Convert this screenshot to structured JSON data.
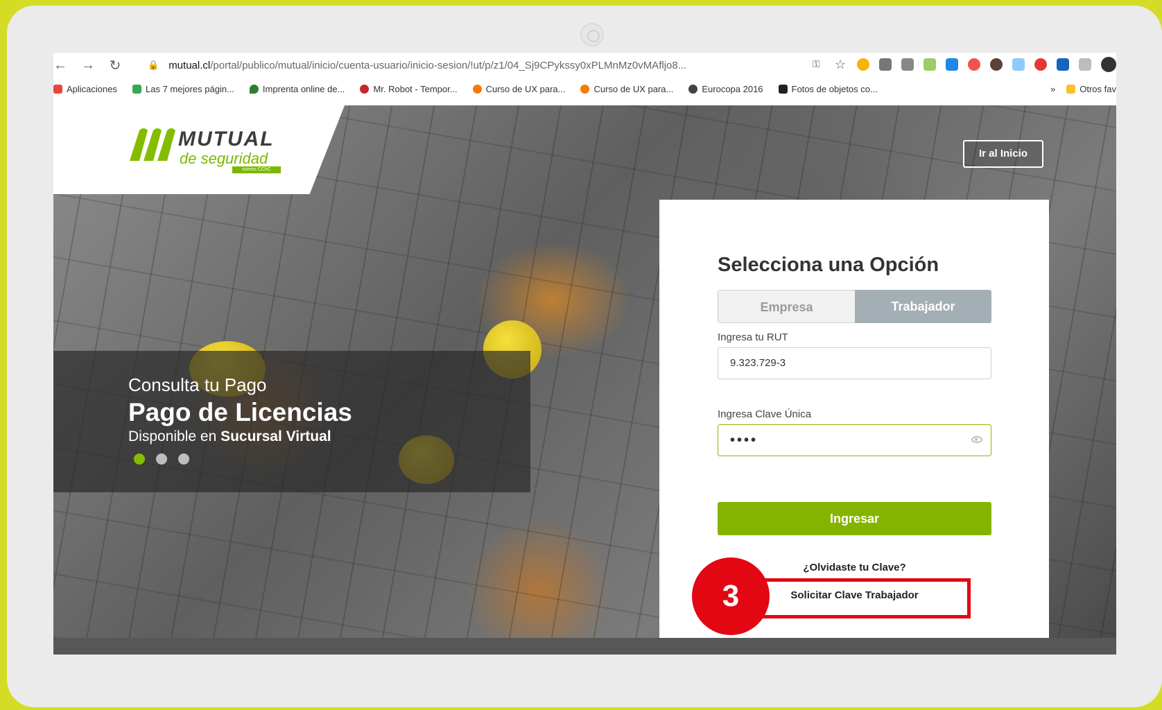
{
  "browser": {
    "url_domain": "mutual.cl",
    "url_path": "/portal/publico/mutual/inicio/cuenta-usuario/inicio-sesion/!ut/p/z1/04_Sj9CPykssy0xPLMnMz0vMAfljo8...",
    "bookmarks": [
      {
        "label": "Aplicaciones",
        "color": "#e8453c"
      },
      {
        "label": "Las 7 mejores págin...",
        "color": "#34a853"
      },
      {
        "label": "Imprenta online de...",
        "color": "#2e7d32"
      },
      {
        "label": "Mr. Robot - Tempor...",
        "color": "#c62828"
      },
      {
        "label": "Curso de UX para...",
        "color": "#f57c00"
      },
      {
        "label": "Curso de UX para...",
        "color": "#f57c00"
      },
      {
        "label": "Eurocopa 2016",
        "color": "#424242"
      },
      {
        "label": "Fotos de objetos co...",
        "color": "#212121"
      }
    ],
    "more_label": "»",
    "other_favorites": "Otros fav"
  },
  "site": {
    "logo": {
      "line1": "MUTUAL",
      "line2": "de seguridad",
      "tag": "somos CChC"
    },
    "ir_inicio": "Ir al Inicio",
    "slide": {
      "subtitle": "Consulta tu Pago",
      "title": "Pago de Licencias",
      "line_prefix": "Disponible en ",
      "line_bold": "Sucursal Virtual"
    }
  },
  "login": {
    "title": "Selecciona una Opción",
    "tab_empresa": "Empresa",
    "tab_trabajador": "Trabajador",
    "rut_label": "Ingresa tu RUT",
    "rut_value": "9.323.729-3",
    "clave_label": "Ingresa Clave Única",
    "clave_value": "••••",
    "submit": "Ingresar",
    "forgot": "¿Olvidaste tu Clave?",
    "solicitar": "Solicitar Clave Trabajador"
  },
  "annotation": {
    "step": "3"
  },
  "colors": {
    "brand_green": "#84b400",
    "annotation_red": "#e30613",
    "frame_yellow": "#d5dc26"
  }
}
